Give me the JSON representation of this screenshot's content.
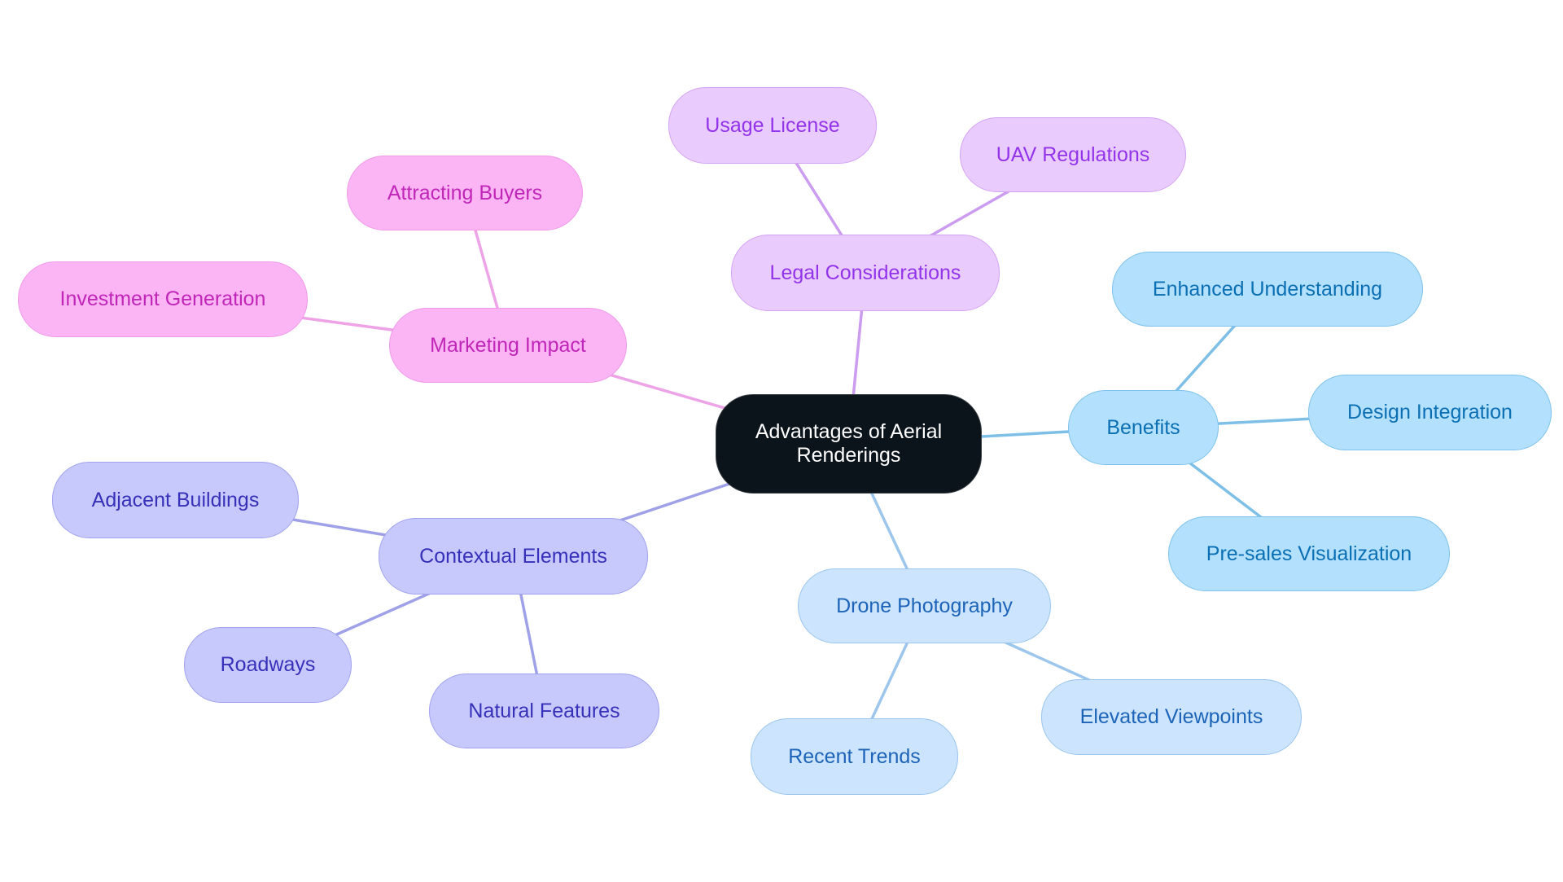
{
  "diagram": {
    "type": "mindmap",
    "root": {
      "id": "root",
      "label": "Advantages of Aerial Renderings"
    },
    "branch_colors": {
      "pink": {
        "fill": "#fbb4f4",
        "border": "#f09ae8",
        "text": "#c026b8",
        "edge": "#eea3e6"
      },
      "purple": {
        "fill": "#e9cbfd",
        "border": "#d4a3f5",
        "text": "#9333ea",
        "edge": "#cc9cf0"
      },
      "blue": {
        "fill": "#b3e0fd",
        "border": "#7dc2ec",
        "text": "#0b6fb3",
        "edge": "#7dbfe6"
      },
      "lightblue": {
        "fill": "#cce4fd",
        "border": "#9ac5ef",
        "text": "#1d64b8",
        "edge": "#9cc6ec"
      },
      "indigo": {
        "fill": "#c7c9fd",
        "border": "#a0a2ee",
        "text": "#3730b8",
        "edge": "#9fa1e8"
      }
    },
    "branches": [
      {
        "id": "marketing",
        "label": "Marketing Impact",
        "color": "pink",
        "children": [
          {
            "id": "investment",
            "label": "Investment Generation"
          },
          {
            "id": "attracting",
            "label": "Attracting Buyers"
          }
        ]
      },
      {
        "id": "legal",
        "label": "Legal Considerations",
        "color": "purple",
        "children": [
          {
            "id": "usage",
            "label": "Usage License"
          },
          {
            "id": "uav",
            "label": "UAV Regulations"
          }
        ]
      },
      {
        "id": "benefits",
        "label": "Benefits",
        "color": "blue",
        "children": [
          {
            "id": "enhanced",
            "label": "Enhanced Understanding"
          },
          {
            "id": "design",
            "label": "Design Integration"
          },
          {
            "id": "presales",
            "label": "Pre-sales Visualization"
          }
        ]
      },
      {
        "id": "drone",
        "label": "Drone Photography",
        "color": "lightblue",
        "children": [
          {
            "id": "elevated",
            "label": "Elevated Viewpoints"
          },
          {
            "id": "recent",
            "label": "Recent Trends"
          }
        ]
      },
      {
        "id": "contextual",
        "label": "Contextual Elements",
        "color": "indigo",
        "children": [
          {
            "id": "adjacent",
            "label": "Adjacent Buildings"
          },
          {
            "id": "roadways",
            "label": "Roadways"
          },
          {
            "id": "natural",
            "label": "Natural Features"
          }
        ]
      }
    ]
  }
}
